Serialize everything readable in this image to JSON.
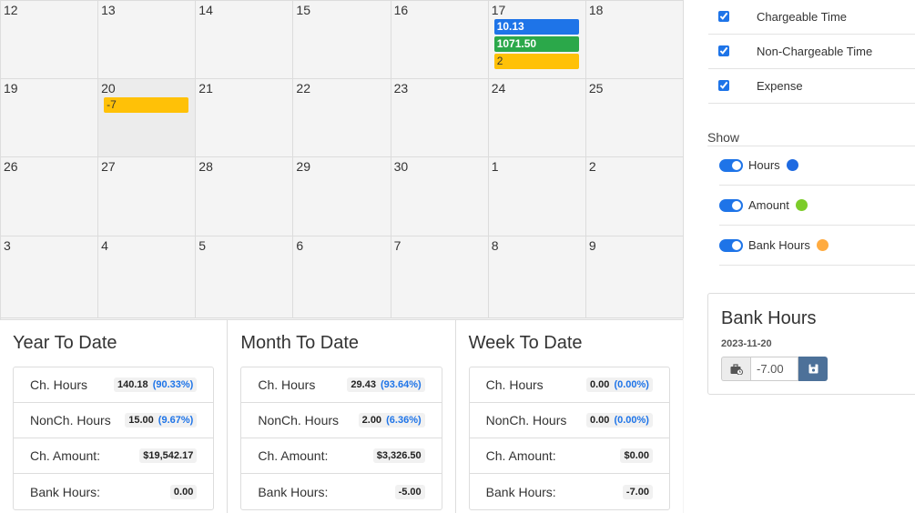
{
  "calendar": {
    "weeks": [
      [
        {
          "day": "12"
        },
        {
          "day": "13"
        },
        {
          "day": "14"
        },
        {
          "day": "15"
        },
        {
          "day": "16"
        },
        {
          "day": "17",
          "events": [
            {
              "text": "10.13",
              "color": "blue"
            },
            {
              "text": "1071.50",
              "color": "green"
            },
            {
              "text": "2",
              "color": "amber"
            }
          ]
        },
        {
          "day": "18"
        }
      ],
      [
        {
          "day": "19"
        },
        {
          "day": "20",
          "today": true,
          "events": [
            {
              "text": "-7",
              "color": "amber"
            }
          ]
        },
        {
          "day": "21"
        },
        {
          "day": "22"
        },
        {
          "day": "23"
        },
        {
          "day": "24"
        },
        {
          "day": "25"
        }
      ],
      [
        {
          "day": "26"
        },
        {
          "day": "27"
        },
        {
          "day": "28"
        },
        {
          "day": "29"
        },
        {
          "day": "30"
        },
        {
          "day": "1"
        },
        {
          "day": "2"
        }
      ],
      [
        {
          "day": "3"
        },
        {
          "day": "4"
        },
        {
          "day": "5"
        },
        {
          "day": "6"
        },
        {
          "day": "7"
        },
        {
          "day": "8"
        },
        {
          "day": "9"
        }
      ]
    ]
  },
  "summaries": [
    {
      "title": "Year To Date",
      "rows": [
        {
          "label": "Ch. Hours",
          "value": "140.18",
          "pct": "(90.33%)"
        },
        {
          "label": "NonCh. Hours",
          "value": "15.00",
          "pct": "(9.67%)"
        },
        {
          "label": "Ch. Amount:",
          "value": "$19,542.17",
          "pct": ""
        },
        {
          "label": "Bank Hours:",
          "value": "0.00",
          "pct": ""
        }
      ]
    },
    {
      "title": "Month To Date",
      "rows": [
        {
          "label": "Ch. Hours",
          "value": "29.43",
          "pct": "(93.64%)"
        },
        {
          "label": "NonCh. Hours",
          "value": "2.00",
          "pct": "(6.36%)"
        },
        {
          "label": "Ch. Amount:",
          "value": "$3,326.50",
          "pct": ""
        },
        {
          "label": "Bank Hours:",
          "value": "-5.00",
          "pct": ""
        }
      ]
    },
    {
      "title": "Week To Date",
      "rows": [
        {
          "label": "Ch. Hours",
          "value": "0.00",
          "pct": "(0.00%)"
        },
        {
          "label": "NonCh. Hours",
          "value": "0.00",
          "pct": "(0.00%)"
        },
        {
          "label": "Ch. Amount:",
          "value": "$0.00",
          "pct": ""
        },
        {
          "label": "Bank Hours:",
          "value": "-7.00",
          "pct": ""
        }
      ]
    }
  ],
  "filters": [
    {
      "label": "Chargeable Time",
      "checked": true
    },
    {
      "label": "Non-Chargeable Time",
      "checked": true
    },
    {
      "label": "Expense",
      "checked": true
    }
  ],
  "show": {
    "title": "Show",
    "toggles": [
      {
        "label": "Hours",
        "dot_color": "#1e6ae1",
        "on": true
      },
      {
        "label": "Amount",
        "dot_color": "#7ccc2a",
        "on": true
      },
      {
        "label": "Bank Hours",
        "dot_color": "#ffab40",
        "on": true
      }
    ]
  },
  "bank": {
    "title": "Bank Hours",
    "date": "2023-11-20",
    "value": "-7.00",
    "prefix_icon": "briefcase-clock-icon",
    "save_icon": "save-icon"
  },
  "colors": {
    "blue": "#1e74e8",
    "green": "#2ba84a",
    "amber": "#ffc107",
    "save_button": "#4d7199"
  }
}
